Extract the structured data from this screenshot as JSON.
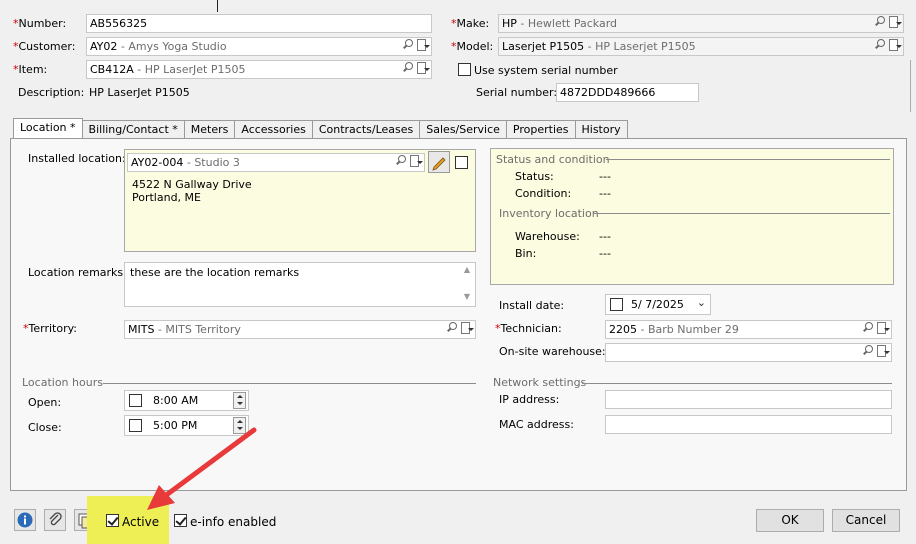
{
  "header": {
    "number_label": "Number:",
    "number_value": "AB556325",
    "customer_label": "Customer:",
    "customer_code": "AY02",
    "customer_name": " - Amys Yoga Studio",
    "item_label": "Item:",
    "item_code": "CB412A",
    "item_name": " - HP LaserJet P1505",
    "description_label": "Description:",
    "description_value": "HP LaserJet P1505",
    "make_label": "Make:",
    "make_code": "HP",
    "make_name": " - Hewlett Packard",
    "model_label": "Model:",
    "model_code": "Laserjet P1505",
    "model_name": " - HP Laserjet P1505",
    "use_serial_label": "Use system serial number",
    "serial_label": "Serial number:",
    "serial_value": "4872DDD489666"
  },
  "tabs": [
    "Location *",
    "Billing/Contact *",
    "Meters",
    "Accessories",
    "Contracts/Leases",
    "Sales/Service",
    "Properties",
    "History"
  ],
  "location": {
    "installed_label": "Installed location:",
    "installed_code": "AY02-004",
    "installed_name": " - Studio 3",
    "address_line1": "4522 N Gallway Drive",
    "address_line2": "Portland, ME",
    "remarks_label": "Location remarks:",
    "remarks_value": "these are the location remarks",
    "territory_label": "Territory:",
    "territory_code": "MITS",
    "territory_name": " - MITS Territory",
    "hours_group": "Location hours",
    "open_label": "Open:",
    "open_value": "8:00 AM",
    "close_label": "Close:",
    "close_value": "5:00 PM"
  },
  "status": {
    "group_label": "Status and condition",
    "status_label": "Status:",
    "status_value": "---",
    "condition_label": "Condition:",
    "condition_value": "---",
    "inventory_group": "Inventory location",
    "warehouse_label": "Warehouse:",
    "warehouse_value": "---",
    "bin_label": "Bin:",
    "bin_value": "---"
  },
  "service": {
    "install_label": "Install date:",
    "install_value": "5/  7/2025",
    "technician_label": "Technician:",
    "technician_code": "2205",
    "technician_name": " - Barb Number 29",
    "onsite_label": "On-site warehouse:",
    "network_group": "Network settings",
    "ip_label": "IP address:",
    "mac_label": "MAC address:"
  },
  "footer": {
    "active_label": "Active",
    "einfo_label": "e-info enabled",
    "ok_label": "OK",
    "cancel_label": "Cancel"
  },
  "colors": {
    "highlight": "#eeee55",
    "arrow": "#e83a3a",
    "required": "#cc0000"
  }
}
